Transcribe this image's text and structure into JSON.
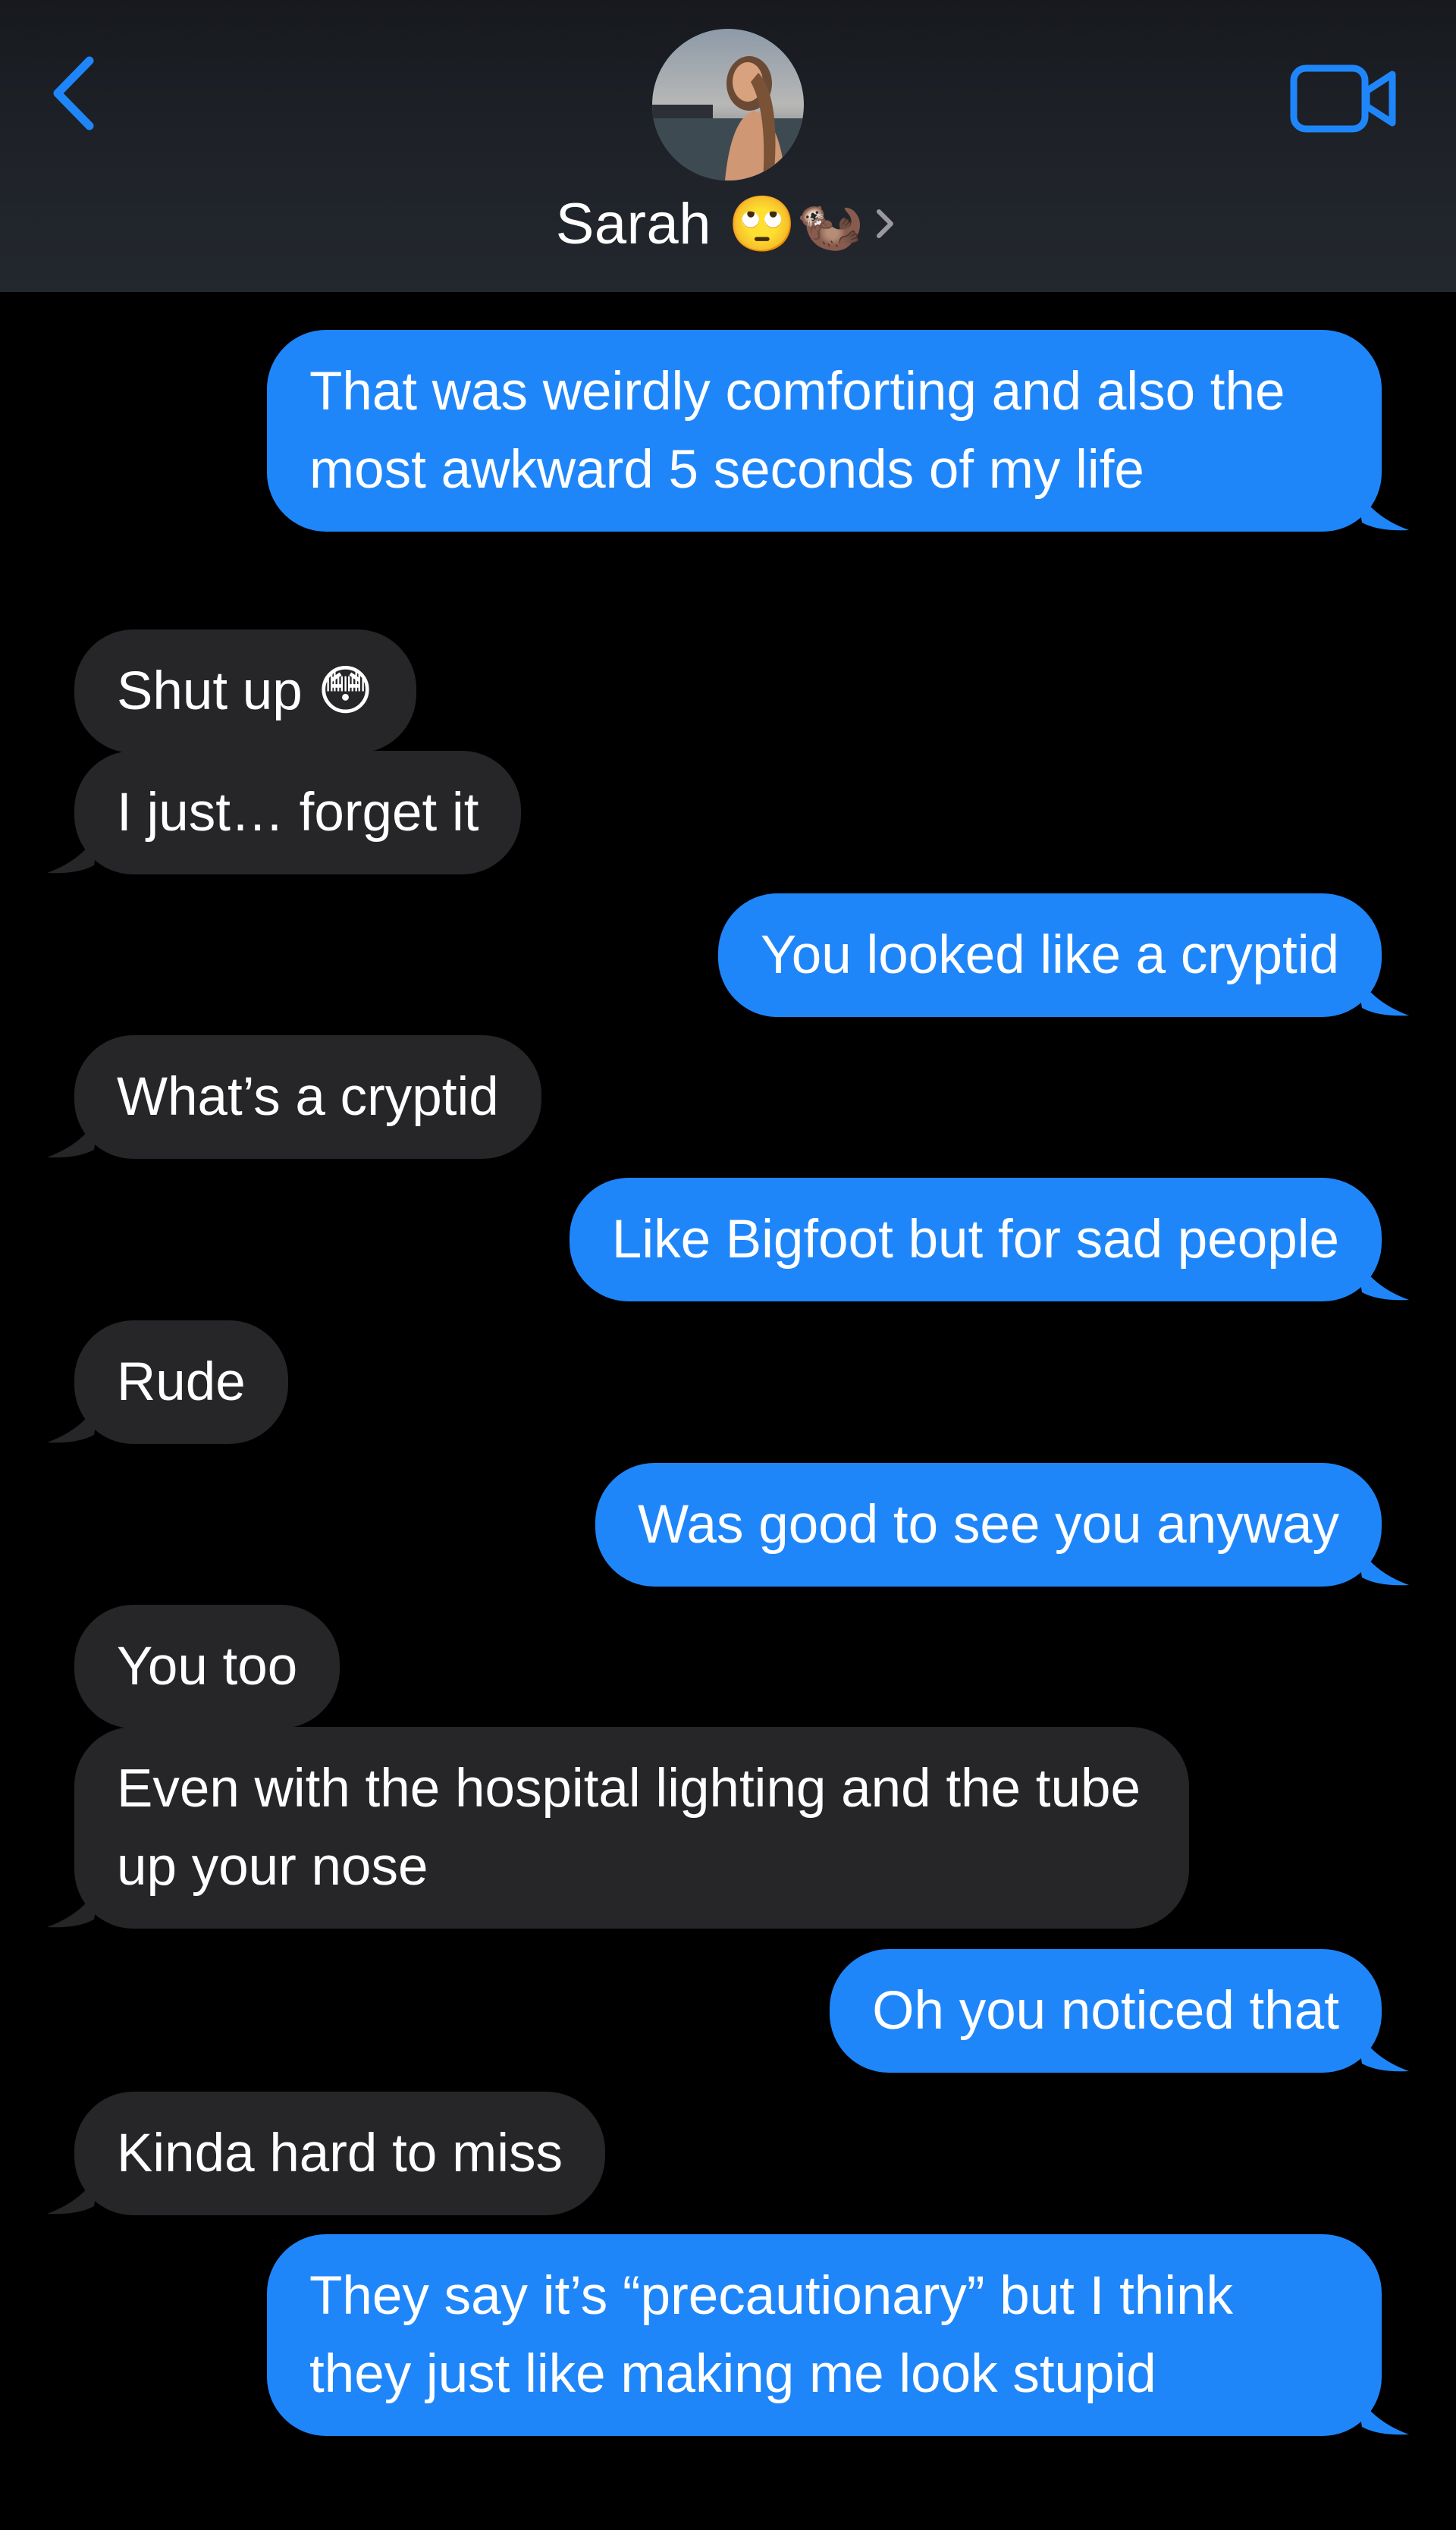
{
  "header": {
    "contact_name": "Sarah",
    "contact_emoji": "🙄🦦",
    "avatar_icon": "contact-photo",
    "back_icon": "chevron-left-icon",
    "video_icon": "video-camera-icon",
    "accent_color": "#1f86fa"
  },
  "messages": [
    {
      "from": "me",
      "text": "That was weirdly comforting and also the most awkward 5 seconds of my life",
      "tail": true
    },
    {
      "from": "them",
      "text": "Shut up 😳",
      "tail": false
    },
    {
      "from": "them",
      "text": "I just… forget it",
      "tail": true
    },
    {
      "from": "me",
      "text": "You looked like a cryptid",
      "tail": true
    },
    {
      "from": "them",
      "text": "What’s a cryptid",
      "tail": true
    },
    {
      "from": "me",
      "text": "Like Bigfoot but for sad people",
      "tail": true
    },
    {
      "from": "them",
      "text": "Rude",
      "tail": true
    },
    {
      "from": "me",
      "text": "Was good to see you anyway",
      "tail": true
    },
    {
      "from": "them",
      "text": "You too",
      "tail": false
    },
    {
      "from": "them",
      "text": "Even with the hospital lighting and the tube up your nose",
      "tail": true
    },
    {
      "from": "me",
      "text": "Oh you noticed that",
      "tail": true
    },
    {
      "from": "them",
      "text": "Kinda hard to miss",
      "tail": true
    },
    {
      "from": "me",
      "text": "They say it’s “precautionary” but I think they just like making me look stupid",
      "tail": true
    }
  ],
  "colors": {
    "sent_bubble": "#1f86fa",
    "received_bubble": "#262628",
    "background": "#000000"
  }
}
